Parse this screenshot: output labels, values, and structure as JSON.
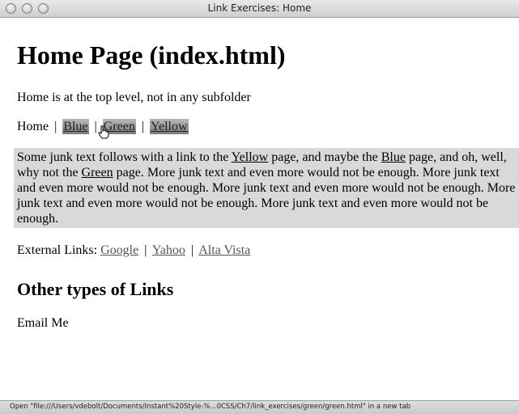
{
  "window": {
    "title": "Link Exercises: Home"
  },
  "page": {
    "heading": "Home Page (index.html)",
    "intro": "Home is at the top level, not in any subfolder",
    "nav": {
      "home": "Home",
      "separator": "|",
      "links": [
        "Blue",
        "Green",
        "Yellow"
      ]
    },
    "junk": {
      "part1": "Some junk text follows with a link to the ",
      "link_yellow": "Yellow",
      "part2": " page, and maybe the ",
      "link_blue": "Blue",
      "part3": " page, and oh, well, why not the ",
      "link_green": "Green",
      "part4": " page. More junk text and even more would not be enough. More junk text and even more would not be enough. More junk text and even more would not be enough. More junk text and even more would not be enough. More junk text and even more would not be enough."
    },
    "external": {
      "label": "External Links: ",
      "separator": "|",
      "links": [
        "Google",
        "Yahoo",
        "Alta Vista"
      ]
    },
    "other_heading": "Other types of Links",
    "email_label": "Email Me"
  },
  "status_bar": {
    "text": "Open \"file:///Users/vdebolt/Documents/Instant%20Style-%...0CSS/Ch7/link_exercises/green/green.html\" in a new tab"
  },
  "colors": {
    "highlight_background": "#d9d9d9",
    "link_highlight": "#7c7c7c"
  },
  "icons": [
    "close-icon",
    "minimize-icon",
    "zoom-icon",
    "hand-pointer-icon"
  ]
}
